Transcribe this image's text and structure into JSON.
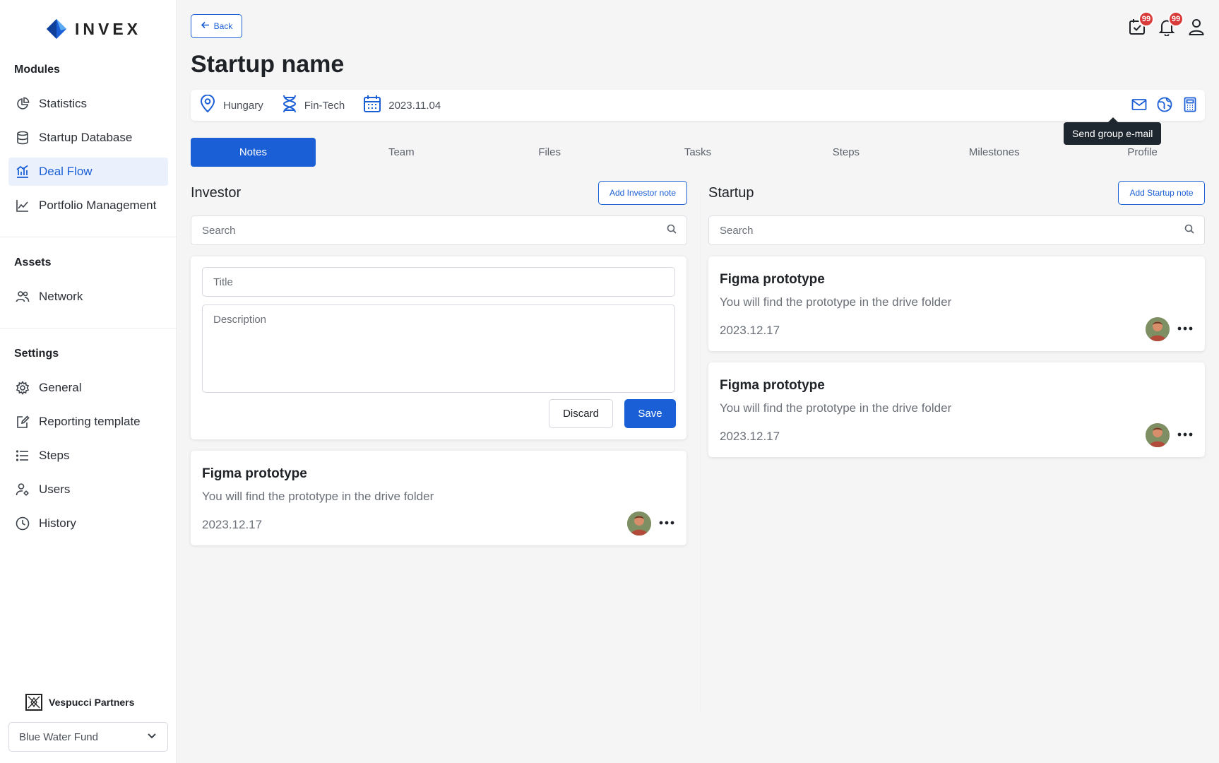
{
  "brand": {
    "name": "INVEX"
  },
  "sidebar": {
    "modules_title": "Modules",
    "modules": [
      {
        "label": "Statistics",
        "icon": "pie-chart-icon"
      },
      {
        "label": "Startup Database",
        "icon": "database-icon"
      },
      {
        "label": "Deal Flow",
        "icon": "bar-chart-icon",
        "active": true
      },
      {
        "label": "Portfolio Management",
        "icon": "line-chart-icon"
      }
    ],
    "assets_title": "Assets",
    "assets": [
      {
        "label": "Network",
        "icon": "people-icon"
      }
    ],
    "settings_title": "Settings",
    "settings": [
      {
        "label": "General",
        "icon": "gear-icon"
      },
      {
        "label": "Reporting template",
        "icon": "edit-document-icon"
      },
      {
        "label": "Steps",
        "icon": "list-icon"
      },
      {
        "label": "Users",
        "icon": "user-settings-icon"
      },
      {
        "label": "History",
        "icon": "clock-icon"
      }
    ],
    "org_name": "Vespucci Partners",
    "fund_selected": "Blue Water Fund"
  },
  "header": {
    "back_label": "Back",
    "title": "Startup name",
    "tasks_badge": "99",
    "notifications_badge": "99"
  },
  "info": {
    "location": "Hungary",
    "industry": "Fin-Tech",
    "date": "2023.11.04",
    "tooltip": "Send group e-mail"
  },
  "tabs": [
    "Notes",
    "Team",
    "Files",
    "Tasks",
    "Steps",
    "Milestones",
    "Profile"
  ],
  "investor": {
    "title": "Investor",
    "add_label": "Add Investor note",
    "search_placeholder": "Search",
    "form": {
      "title_placeholder": "Title",
      "description_placeholder": "Description",
      "discard_label": "Discard",
      "save_label": "Save"
    },
    "notes": [
      {
        "title": "Figma prototype",
        "description": "You will find the prototype in the drive folder",
        "date": "2023.12.17"
      }
    ]
  },
  "startup": {
    "title": "Startup",
    "add_label": "Add Startup note",
    "search_placeholder": "Search",
    "notes": [
      {
        "title": "Figma prototype",
        "description": "You will find the prototype in the drive folder",
        "date": "2023.12.17"
      },
      {
        "title": "Figma prototype",
        "description": "You will find the prototype in the drive folder",
        "date": "2023.12.17"
      }
    ]
  },
  "colors": {
    "primary": "#1b5fd6",
    "badge": "#d93a3a",
    "tooltip_bg": "#1e2630",
    "active_nav_bg": "#eaf1fd"
  }
}
